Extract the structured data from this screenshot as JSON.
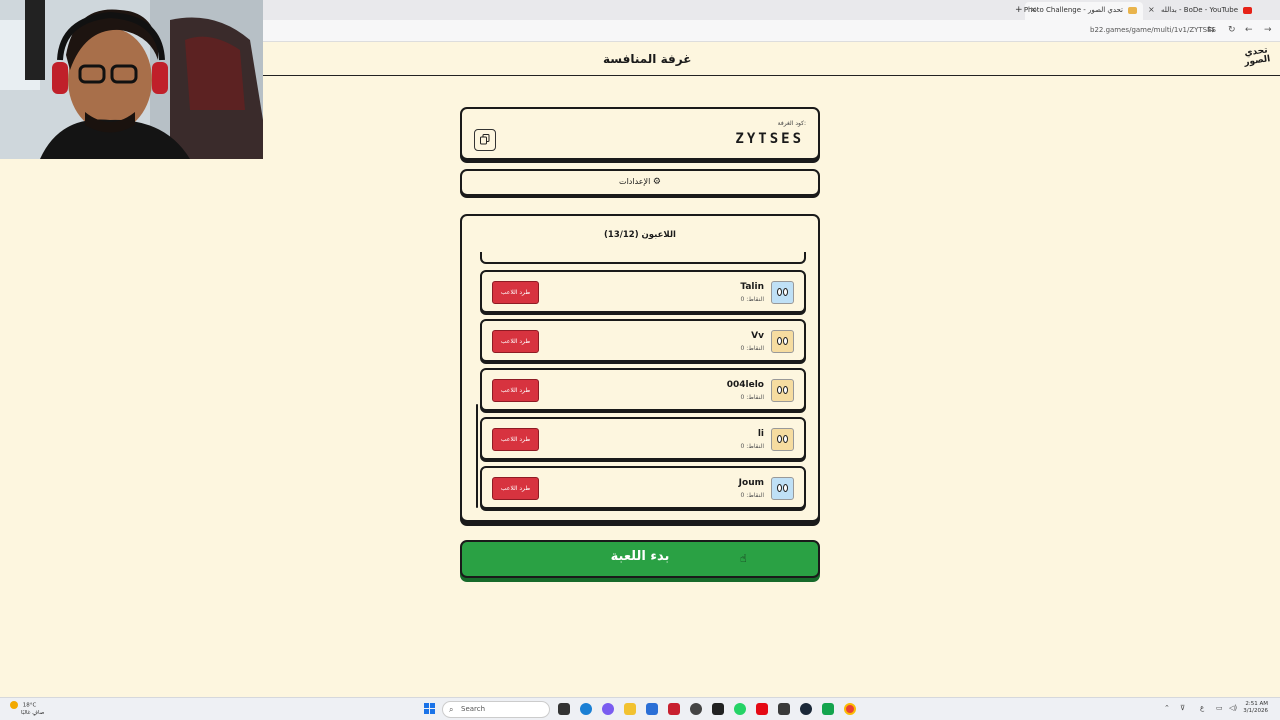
{
  "browser": {
    "tabs": [
      {
        "label": "بدالله - BoDe - YouTube",
        "active": false
      },
      {
        "label": "Photo Challenge - تحدي الصور",
        "active": true
      }
    ],
    "new_tab": "+",
    "close": "×",
    "url": "b22.games/game/multi/1v1/ZYTSES"
  },
  "header": {
    "title": "غرفة المنافسة",
    "logo_text": "تحدي الصور"
  },
  "room": {
    "code_label": "كود الغرفة:",
    "code": "ZYTSES",
    "copy_icon": "copy-icon"
  },
  "settings": {
    "label": "الإعدادات",
    "icon": "gear-icon"
  },
  "players": {
    "title": "اللاعبون (13/12)",
    "kick_label": "طرد اللاعب",
    "list": [
      {
        "name": "Talin",
        "score": "النقاط: 0",
        "avatar_color": "#bfe0f6"
      },
      {
        "name": "Vv",
        "score": "النقاط: 0",
        "avatar_color": "#f6dca0"
      },
      {
        "name": "004lelo",
        "score": "النقاط: 0",
        "avatar_color": "#f6dca0"
      },
      {
        "name": "li",
        "score": "النقاط: 0",
        "avatar_color": "#f6dca0"
      },
      {
        "name": "Joum",
        "score": "النقاط: 0",
        "avatar_color": "#bfe0f6"
      }
    ]
  },
  "start_button": "بدء اللعبة",
  "taskbar": {
    "weather_temp": "18°C",
    "weather_desc": "صافٍ غالبًا",
    "search": "Search",
    "time": "2:51 AM",
    "date": "3/1/2026",
    "lang": "ع"
  },
  "colors": {
    "page_bg": "#fdf6df",
    "kick_red": "#d7333f",
    "start_green": "#2aa144"
  }
}
